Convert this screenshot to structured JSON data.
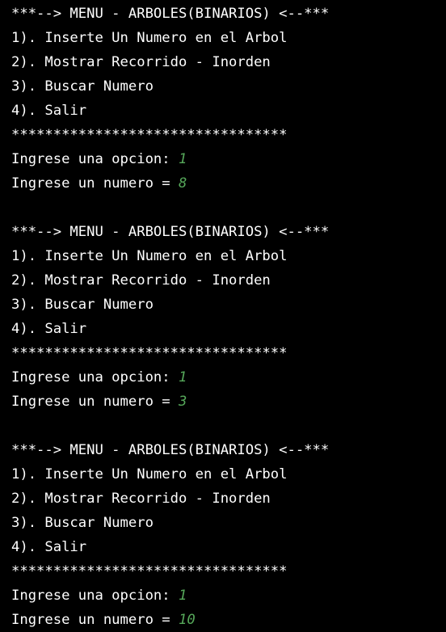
{
  "console": {
    "blocks": [
      {
        "menu_title": "***--> MENU - ARBOLES(BINARIOS) <--***",
        "options": [
          "1). Inserte Un Numero en el Arbol",
          "2). Mostrar Recorrido - Inorden",
          "3). Buscar Numero",
          "4). Salir"
        ],
        "separator": "*********************************",
        "prompt_option": "Ingrese una opcion: ",
        "option_value": "1",
        "prompt_number": "Ingrese un numero = ",
        "number_value": "8"
      },
      {
        "menu_title": "***--> MENU - ARBOLES(BINARIOS) <--***",
        "options": [
          "1). Inserte Un Numero en el Arbol",
          "2). Mostrar Recorrido - Inorden",
          "3). Buscar Numero",
          "4). Salir"
        ],
        "separator": "*********************************",
        "prompt_option": "Ingrese una opcion: ",
        "option_value": "1",
        "prompt_number": "Ingrese un numero = ",
        "number_value": "3"
      },
      {
        "menu_title": "***--> MENU - ARBOLES(BINARIOS) <--***",
        "options": [
          "1). Inserte Un Numero en el Arbol",
          "2). Mostrar Recorrido - Inorden",
          "3). Buscar Numero",
          "4). Salir"
        ],
        "separator": "*********************************",
        "prompt_option": "Ingrese una opcion: ",
        "option_value": "1",
        "prompt_number": "Ingrese un numero = ",
        "number_value": "10"
      }
    ]
  },
  "colors": {
    "background": "#000000",
    "text": "#ffffff",
    "user_input": "#56a85a"
  }
}
